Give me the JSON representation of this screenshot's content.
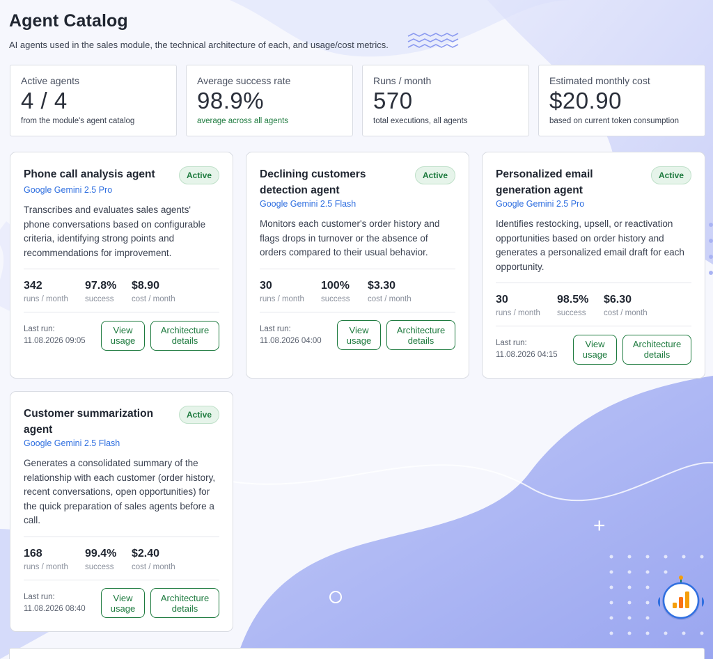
{
  "header": {
    "title": "Agent Catalog",
    "subtitle": "AI agents used in the sales module, the technical architecture of each, and usage/cost metrics."
  },
  "stats": [
    {
      "label": "Active agents",
      "value": "4 / 4",
      "note": "from the module's agent catalog"
    },
    {
      "label": "Average success rate",
      "value": "98.9%",
      "note": "average across all agents"
    },
    {
      "label": "Runs / month",
      "value": "570",
      "note": "total executions, all agents"
    },
    {
      "label": "Estimated monthly cost",
      "value": "$20.90",
      "note": "based on current token consumption"
    }
  ],
  "labels": {
    "runs": "runs / month",
    "success": "success",
    "cost": "cost / month",
    "last_run": "Last run:",
    "view_usage": "View usage",
    "architecture": "Architecture details"
  },
  "agents": [
    {
      "name": "Phone call analysis agent",
      "status": "Active",
      "model": "Google Gemini 2.5 Pro",
      "description": "Transcribes and evaluates sales agents' phone conversations based on configurable criteria, identifying strong points and recommendations for improvement.",
      "runs": "342",
      "success": "97.8%",
      "cost": "$8.90",
      "last_run": "11.08.2026 09:05"
    },
    {
      "name": "Declining customers detection agent",
      "status": "Active",
      "model": "Google Gemini 2.5 Flash",
      "description": "Monitors each customer's order history and flags drops in turnover or the absence of orders compared to their usual behavior.",
      "runs": "30",
      "success": "100%",
      "cost": "$3.30",
      "last_run": "11.08.2026 04:00"
    },
    {
      "name": "Personalized email generation agent",
      "status": "Active",
      "model": "Google Gemini 2.5 Pro",
      "description": "Identifies restocking, upsell, or reactivation opportunities based on order history and generates a personalized email draft for each opportunity.",
      "runs": "30",
      "success": "98.5%",
      "cost": "$6.30",
      "last_run": "11.08.2026 04:15"
    },
    {
      "name": "Customer summarization agent",
      "status": "Active",
      "model": "Google Gemini 2.5 Flash",
      "description": "Generates a consolidated summary of the relationship with each customer (order history, recent conversations, open opportunities) for the quick preparation of sales agents before a call.",
      "runs": "168",
      "success": "99.4%",
      "cost": "$2.40",
      "last_run": "11.08.2026 08:40"
    }
  ],
  "decor": {
    "wave_icon": "wave-lines-icon",
    "mascot_icon": "analytics-mascot-icon",
    "plus_icon": "plus-sparkle-icon",
    "plus_glyph": "+"
  },
  "colors": {
    "accent_green": "#1d7a3e",
    "model_blue": "#2f6fe0",
    "background_blob": "#a9b3f3"
  }
}
